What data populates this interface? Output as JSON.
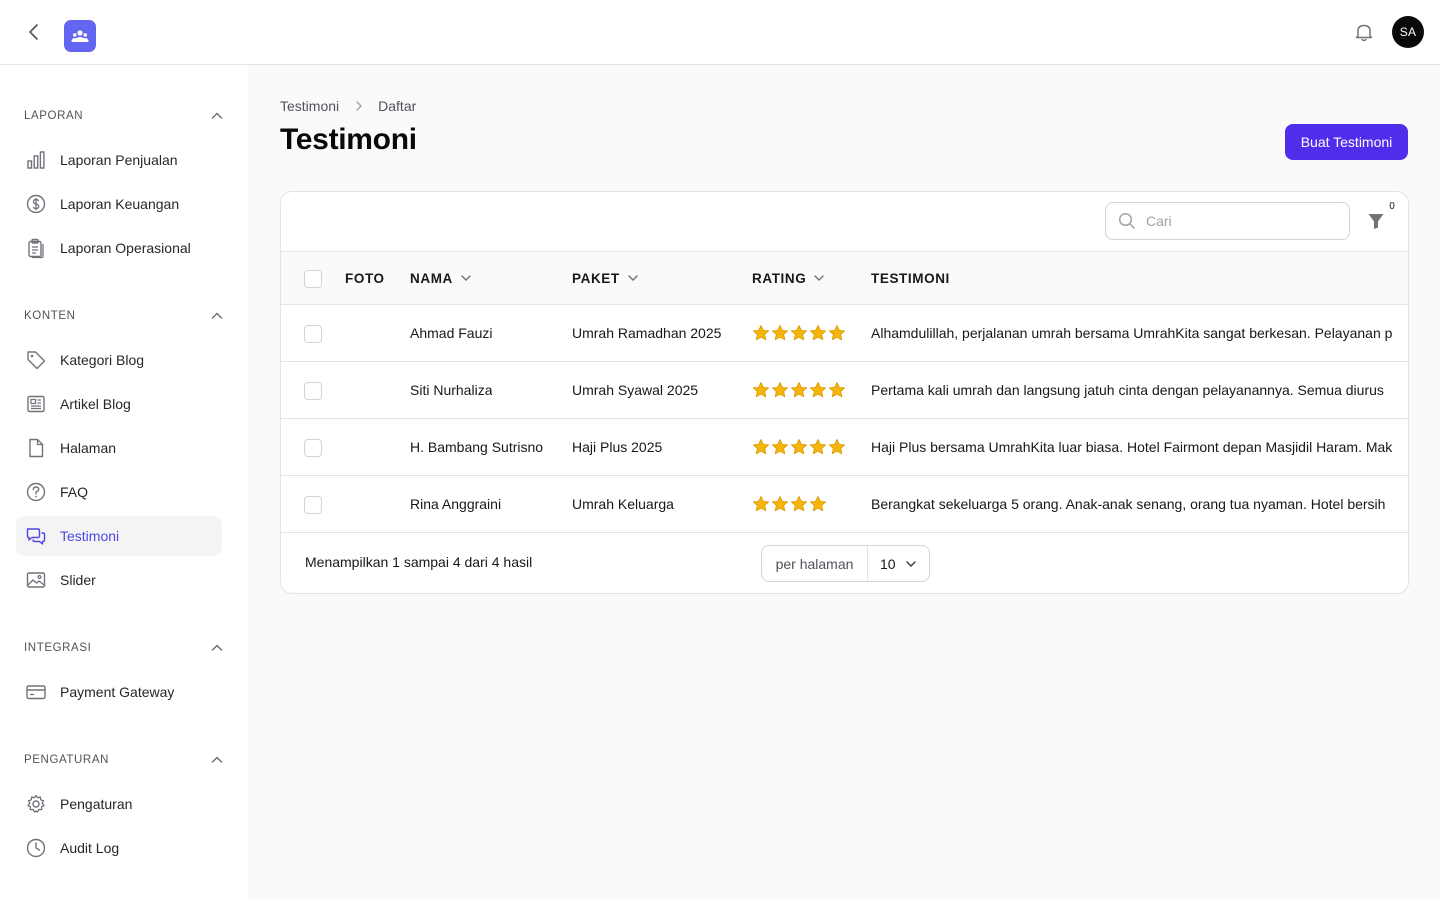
{
  "topbar": {
    "avatar_initials": "SA",
    "accent": "#6366f1"
  },
  "sidebar": {
    "groups": [
      {
        "label": "LAPORAN",
        "items": [
          {
            "label": "Laporan Penjualan",
            "icon": "bar-chart-icon"
          },
          {
            "label": "Laporan Keuangan",
            "icon": "dollar-circle-icon"
          },
          {
            "label": "Laporan Operasional",
            "icon": "clipboard-icon"
          }
        ]
      },
      {
        "label": "KONTEN",
        "items": [
          {
            "label": "Kategori Blog",
            "icon": "tag-icon"
          },
          {
            "label": "Artikel Blog",
            "icon": "newspaper-icon"
          },
          {
            "label": "Halaman",
            "icon": "document-icon"
          },
          {
            "label": "FAQ",
            "icon": "question-circle-icon"
          },
          {
            "label": "Testimoni",
            "icon": "chat-bubbles-icon",
            "active": true
          },
          {
            "label": "Slider",
            "icon": "image-icon"
          }
        ]
      },
      {
        "label": "INTEGRASI",
        "items": [
          {
            "label": "Payment Gateway",
            "icon": "credit-card-icon"
          }
        ]
      },
      {
        "label": "PENGATURAN",
        "items": [
          {
            "label": "Pengaturan",
            "icon": "cog-icon"
          },
          {
            "label": "Audit Log",
            "icon": "clock-icon"
          }
        ]
      }
    ]
  },
  "breadcrumb": {
    "parent": "Testimoni",
    "current": "Daftar"
  },
  "page": {
    "title": "Testimoni",
    "create_label": "Buat Testimoni",
    "create_color": "#4f2dea"
  },
  "toolbar": {
    "search_placeholder": "Cari",
    "filter_count": "0"
  },
  "table": {
    "columns": {
      "foto": "FOTO",
      "nama": "NAMA",
      "paket": "PAKET",
      "rating": "RATING",
      "testimoni": "TESTIMONI"
    },
    "rows": [
      {
        "nama": "Ahmad Fauzi",
        "paket": "Umrah Ramadhan 2025",
        "rating": 5,
        "testimoni": "Alhamdulillah, perjalanan umrah bersama UmrahKita sangat berkesan. Pelayanan p"
      },
      {
        "nama": "Siti Nurhaliza",
        "paket": "Umrah Syawal 2025",
        "rating": 5,
        "testimoni": "Pertama kali umrah dan langsung jatuh cinta dengan pelayanannya. Semua diurus"
      },
      {
        "nama": "H. Bambang Sutrisno",
        "paket": "Haji Plus 2025",
        "rating": 5,
        "testimoni": "Haji Plus bersama UmrahKita luar biasa. Hotel Fairmont depan Masjidil Haram. Mak"
      },
      {
        "nama": "Rina Anggraini",
        "paket": "Umrah Keluarga",
        "rating": 4,
        "testimoni": "Berangkat sekeluarga 5 orang. Anak-anak senang, orang tua nyaman. Hotel bersih"
      }
    ],
    "star_color": "#f5b50a"
  },
  "pagination": {
    "summary": "Menampilkan 1 sampai 4 dari 4 hasil",
    "per_page_label": "per halaman",
    "per_page_value": "10"
  }
}
